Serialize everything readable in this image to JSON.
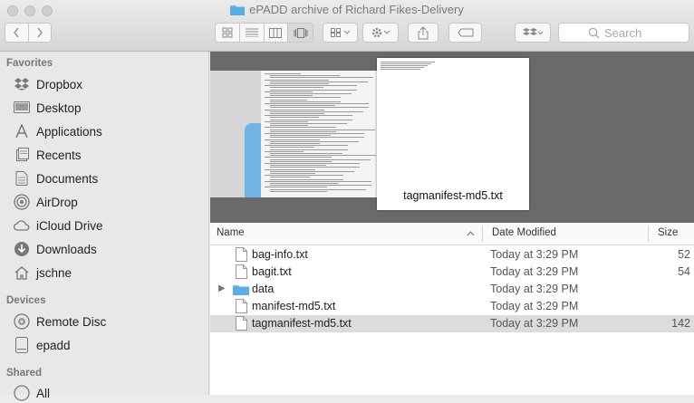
{
  "window": {
    "title": "ePADD archive of Richard Fikes-Delivery"
  },
  "toolbar": {
    "search_placeholder": "Search"
  },
  "sidebar": {
    "favorites_label": "Favorites",
    "favorites": [
      {
        "label": "Dropbox",
        "icon": "dropbox-icon"
      },
      {
        "label": "Desktop",
        "icon": "desktop-icon"
      },
      {
        "label": "Applications",
        "icon": "applications-icon"
      },
      {
        "label": "Recents",
        "icon": "recents-icon"
      },
      {
        "label": "Documents",
        "icon": "documents-icon"
      },
      {
        "label": "AirDrop",
        "icon": "airdrop-icon"
      },
      {
        "label": "iCloud Drive",
        "icon": "cloud-icon"
      },
      {
        "label": "Downloads",
        "icon": "downloads-icon"
      },
      {
        "label": "jschne",
        "icon": "home-icon"
      }
    ],
    "devices_label": "Devices",
    "devices": [
      {
        "label": "Remote Disc",
        "icon": "disc-icon"
      },
      {
        "label": "epadd",
        "icon": "drive-icon"
      }
    ],
    "shared_label": "Shared",
    "shared": [
      {
        "label": "All",
        "icon": "network-icon"
      }
    ]
  },
  "preview": {
    "caption": "tagmanifest-md5.txt"
  },
  "list": {
    "columns": {
      "name": "Name",
      "date": "Date Modified",
      "size": "Size"
    },
    "rows": [
      {
        "name": "bag-info.txt",
        "date": "Today at 3:29 PM",
        "size": "52",
        "type": "file"
      },
      {
        "name": "bagit.txt",
        "date": "Today at 3:29 PM",
        "size": "54",
        "type": "file"
      },
      {
        "name": "data",
        "date": "Today at 3:29 PM",
        "size": "",
        "type": "folder"
      },
      {
        "name": "manifest-md5.txt",
        "date": "Today at 3:29 PM",
        "size": "",
        "type": "file"
      },
      {
        "name": "tagmanifest-md5.txt",
        "date": "Today at 3:29 PM",
        "size": "142",
        "type": "file",
        "selected": true
      }
    ]
  },
  "colors": {
    "folder_blue": "#5aaee8",
    "selection_gray": "#dcdcdc"
  }
}
